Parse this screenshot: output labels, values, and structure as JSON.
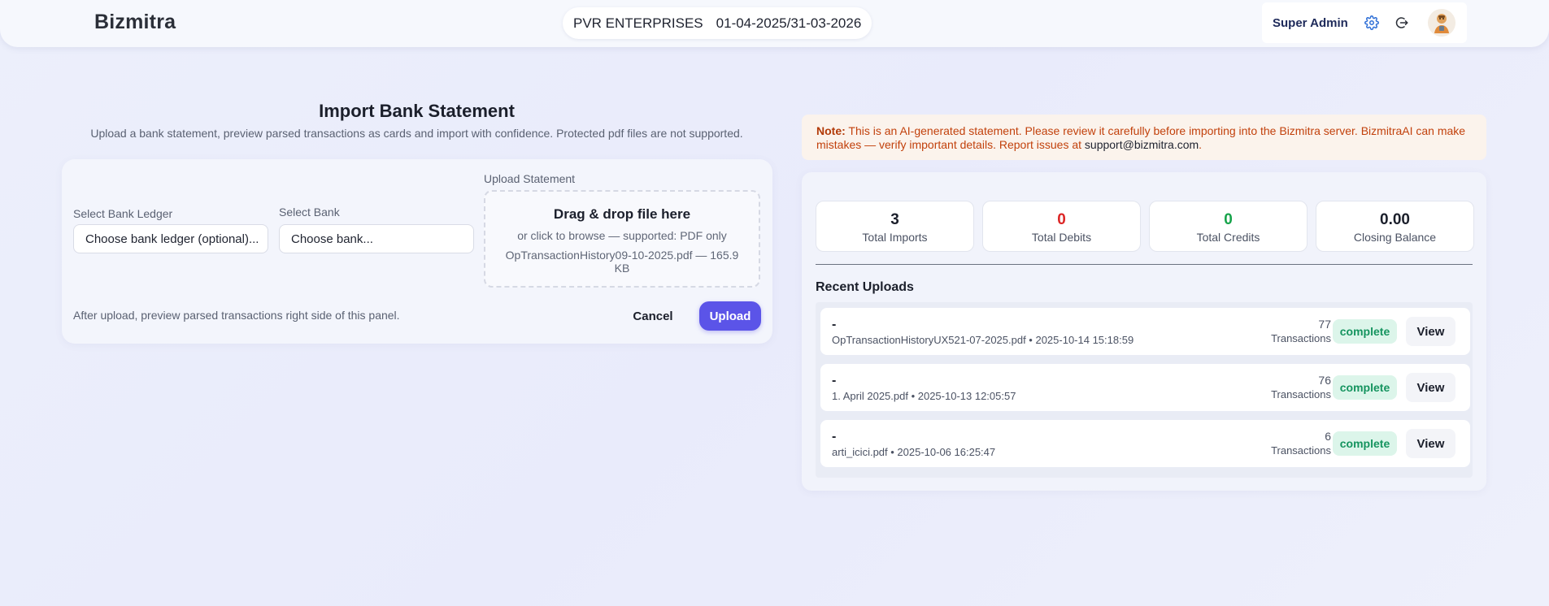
{
  "header": {
    "brand": "Bizmitra",
    "company": "PVR ENTERPRISES",
    "fiscal_period": "01-04-2025/31-03-2026",
    "user_role": "Super Admin"
  },
  "import": {
    "title": "Import Bank Statement",
    "subtitle": "Upload a bank statement, preview parsed transactions as cards and import with confidence. Protected pdf files are not supported.",
    "ledger_label": "Select Bank Ledger",
    "ledger_value": "Choose bank ledger (optional)...",
    "bank_label": "Select Bank",
    "bank_value": "Choose bank...",
    "upload_label": "Upload Statement",
    "dropzone_title": "Drag & drop file here",
    "dropzone_hint": "or click to browse — supported: PDF only",
    "selected_file": "OpTransactionHistory09-10-2025.pdf — 165.9 KB",
    "after_note": "After upload, preview parsed transactions right side of this panel.",
    "cancel_label": "Cancel",
    "upload_label_btn": "Upload"
  },
  "note": {
    "prefix": "Note:",
    "text": " This is an AI-generated statement. Please review it carefully before importing into the Bizmitra server. BizmitraAI can make mistakes — verify important details. Report issues at ",
    "email": "support@bizmitra.com",
    "suffix": "."
  },
  "stats": [
    {
      "value": "3",
      "label": "Total Imports",
      "color": "#1b1f2b"
    },
    {
      "value": "0",
      "label": "Total Debits",
      "color": "#dc2626"
    },
    {
      "value": "0",
      "label": "Total Credits",
      "color": "#16a34a"
    },
    {
      "value": "0.00",
      "label": "Closing Balance",
      "color": "#1b1f2b"
    }
  ],
  "recent": {
    "title": "Recent Uploads",
    "tx_label": "Transactions",
    "view_label": "View",
    "items": [
      {
        "name": "-",
        "meta": "OpTransactionHistoryUX521-07-2025.pdf • 2025-10-14 15:18:59",
        "count": "77",
        "status": "complete"
      },
      {
        "name": "-",
        "meta": "1. April 2025.pdf • 2025-10-13 12:05:57",
        "count": "76",
        "status": "complete"
      },
      {
        "name": "-",
        "meta": "arti_icici.pdf • 2025-10-06 16:25:47",
        "count": "6",
        "status": "complete"
      }
    ]
  },
  "icons": {
    "settings": "gear-icon",
    "logout": "logout-icon",
    "avatar": "avatar"
  }
}
